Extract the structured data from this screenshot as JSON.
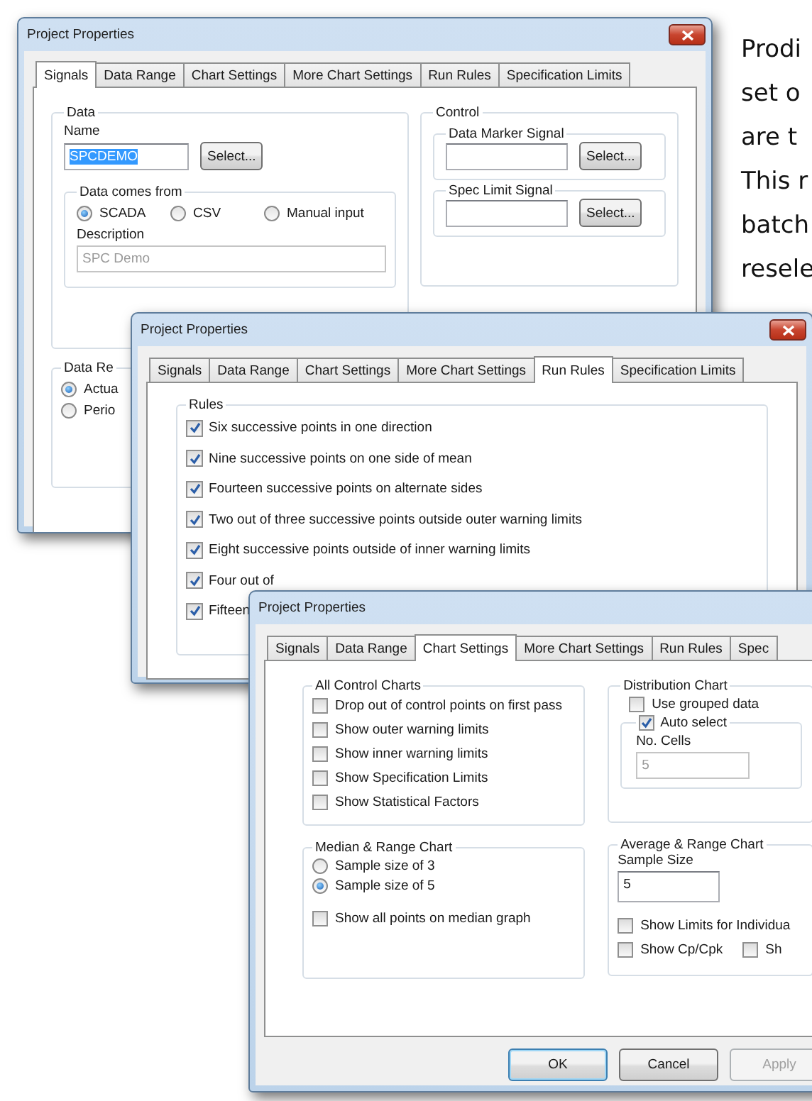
{
  "signals_dialog": {
    "title": "Project Properties",
    "tabs": [
      {
        "label": "Signals",
        "selected": true
      },
      {
        "label": "Data Range",
        "selected": false
      },
      {
        "label": "Chart Settings",
        "selected": false
      },
      {
        "label": "More Chart Settings",
        "selected": false
      },
      {
        "label": "Run Rules",
        "selected": false
      },
      {
        "label": "Specification Limits",
        "selected": false
      }
    ],
    "data_group": {
      "label": "Data",
      "name_label": "Name",
      "name_field": {
        "value": "SPCDEMO",
        "selected": true
      },
      "select_button": "Select...",
      "source_group": {
        "label": "Data comes from",
        "options": [
          {
            "label": "SCADA",
            "selected": true
          },
          {
            "label": "CSV",
            "selected": false
          },
          {
            "label": "Manual input",
            "selected": false
          }
        ]
      },
      "description_label": "Description",
      "description_field": {
        "value": "SPC Demo",
        "disabled": true
      }
    },
    "range_group": {
      "label": "Data Re",
      "options": [
        {
          "label": "Actua",
          "selected": true
        },
        {
          "label": "Perio",
          "selected": false
        }
      ]
    },
    "control_group": {
      "label": "Control",
      "signals": [
        {
          "label": "Data Marker Signal",
          "button": "Select..."
        },
        {
          "label": "Spec Limit Signal",
          "button": "Select..."
        }
      ]
    }
  },
  "run_rules_dialog": {
    "title": "Project Properties",
    "tabs": [
      {
        "label": "Signals",
        "selected": false
      },
      {
        "label": "Data Range",
        "selected": false
      },
      {
        "label": "Chart Settings",
        "selected": false
      },
      {
        "label": "More Chart Settings",
        "selected": false
      },
      {
        "label": "Run Rules",
        "selected": true
      },
      {
        "label": "Specification Limits",
        "selected": false
      }
    ],
    "rules_group": {
      "label": "Rules",
      "rules": [
        {
          "label": "Six successive points in one direction",
          "checked": true
        },
        {
          "label": "Nine successive points on one side of mean",
          "checked": true
        },
        {
          "label": "Fourteen successive points on alternate sides",
          "checked": true
        },
        {
          "label": "Two out of three successive points outside outer warning limits",
          "checked": true
        },
        {
          "label": "Eight successive points outside of inner warning limits",
          "checked": true
        },
        {
          "label": "Four out of",
          "checked": true
        },
        {
          "label": "Fifteen",
          "checked": true
        }
      ]
    }
  },
  "chart_settings_dialog": {
    "title": "Project Properties",
    "tabs": [
      {
        "label": "Signals",
        "selected": false
      },
      {
        "label": "Data Range",
        "selected": false
      },
      {
        "label": "Chart Settings",
        "selected": true
      },
      {
        "label": "More Chart Settings",
        "selected": false
      },
      {
        "label": "Run Rules",
        "selected": false
      },
      {
        "label": "Spec",
        "selected": false
      }
    ],
    "control_charts": {
      "label": "All Control Charts",
      "options": [
        {
          "label": "Drop out of control points on first pass",
          "checked": false
        },
        {
          "label": "Show outer warning limits",
          "checked": false
        },
        {
          "label": "Show inner warning limits",
          "checked": false
        },
        {
          "label": "Show Specification Limits",
          "checked": false
        },
        {
          "label": "Show Statistical Factors",
          "checked": false
        }
      ]
    },
    "distribution": {
      "label": "Distribution Chart",
      "grouped": {
        "label": "Use grouped data",
        "checked": false
      },
      "auto_select": {
        "label": "Auto select",
        "checked": true
      },
      "cells_label": "No. Cells",
      "cells_field": {
        "value": "5",
        "disabled": true
      }
    },
    "median_range": {
      "label": "Median & Range Chart",
      "sizes": [
        {
          "label": "Sample size of 3",
          "selected": false
        },
        {
          "label": "Sample size of 5",
          "selected": true
        }
      ],
      "show_all": {
        "label": "Show all points on median graph",
        "checked": false
      }
    },
    "average_range": {
      "label": "Average & Range Chart",
      "size_label": "Sample Size",
      "size_field": {
        "value": "5",
        "disabled": false
      },
      "option_rows": [
        [
          {
            "label": "Show Limits for Individua",
            "checked": false
          }
        ],
        [
          {
            "label": "Show Cp/Cpk",
            "checked": false
          },
          {
            "label": "Sh",
            "checked": false
          }
        ]
      ]
    },
    "buttons": [
      {
        "label": "OK",
        "kind": "default"
      },
      {
        "label": "Cancel",
        "kind": "normal"
      },
      {
        "label": "Apply",
        "kind": "disabled"
      }
    ]
  },
  "side_text": {
    "lines": [
      "Prodi",
      "set o",
      "are t",
      "This r",
      "batch",
      "resele"
    ]
  }
}
